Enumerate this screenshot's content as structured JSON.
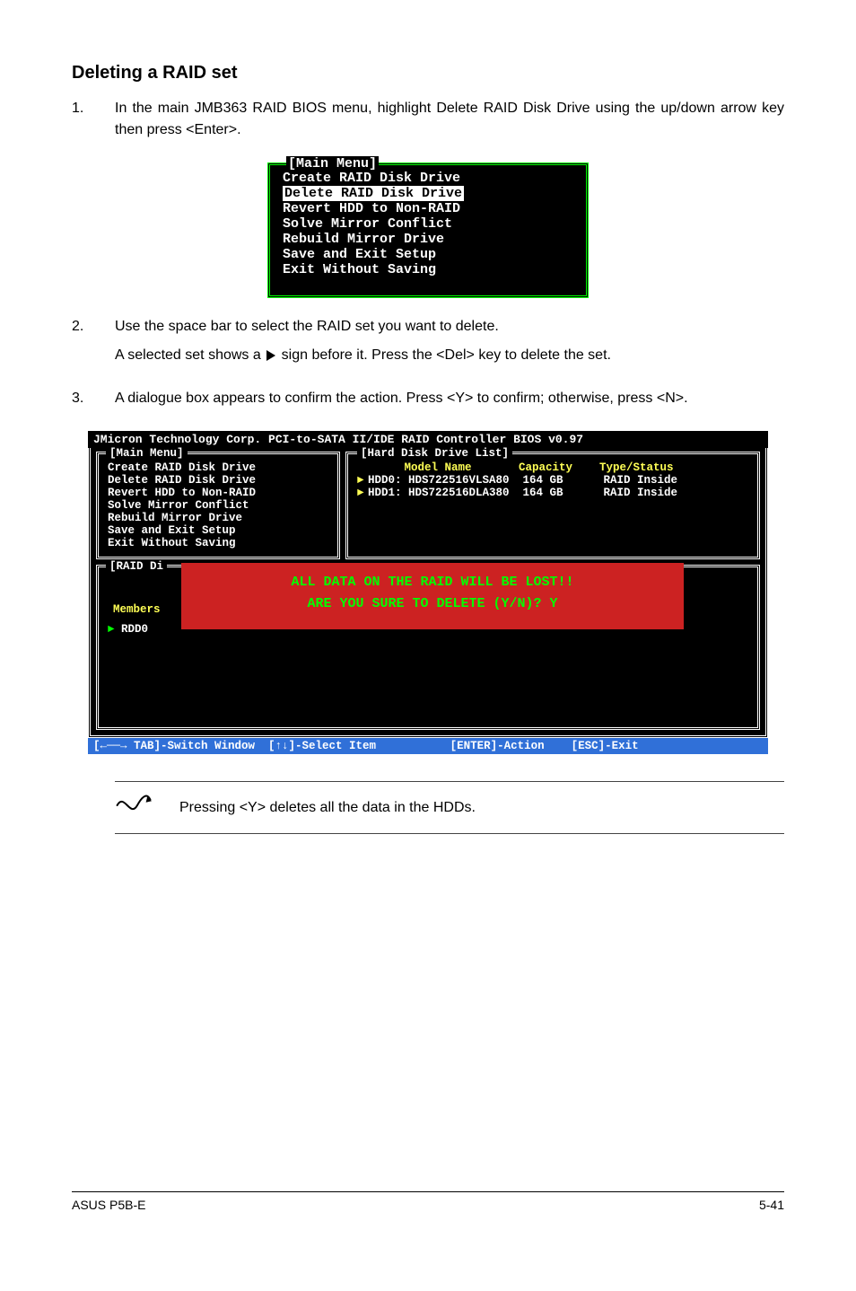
{
  "heading": "Deleting a RAID set",
  "steps": {
    "s1_num": "1.",
    "s1_text": "In the main JMB363 RAID BIOS menu, highlight Delete RAID Disk Drive using the up/down arrow key then press <Enter>.",
    "s2_num": "2.",
    "s2_text_a": "Use the space bar to select the RAID set you want to delete.",
    "s2_text_b_pre": "A selected set shows a ",
    "s2_text_b_post": " sign before it. Press the <Del> key to delete the set.",
    "s3_num": "3.",
    "s3_text": "A dialogue box appears to confirm the action. Press <Y> to confirm; otherwise, press <N>."
  },
  "bios_small": {
    "title": "[Main Menu]",
    "items": [
      "Create RAID Disk Drive",
      "Delete RAID Disk Drive",
      "Revert HDD to Non-RAID",
      "Solve Mirror Conflict",
      "Rebuild Mirror Drive",
      "Save and Exit Setup",
      "Exit Without Saving"
    ],
    "selected_index": 1
  },
  "bios_wide": {
    "header": "JMicron Technology Corp. PCI-to-SATA II/IDE RAID Controller BIOS v0.97",
    "left_title": "[Main Menu]",
    "left_items": [
      "Create RAID Disk Drive",
      "Delete RAID Disk Drive",
      "Revert HDD to Non-RAID",
      "Solve Mirror Conflict",
      "Rebuild Mirror Drive",
      "Save and Exit Setup",
      "Exit Without Saving"
    ],
    "right_title": "[Hard Disk Drive List]",
    "right_header": "       Model Name       Capacity    Type/Status",
    "right_rows": [
      "HDD0: HDS722516VLSA80  164 GB      RAID Inside",
      "HDD1: HDS722516DLA380  164 GB      RAID Inside"
    ],
    "raid_title": "[RAID Di",
    "members_label": "Members",
    "rdd_label": "RDD0",
    "redbox_line1": "ALL DATA ON THE RAID WILL BE LOST!!",
    "redbox_line2": "ARE YOU SURE TO DELETE (Y/N)? Y",
    "footer": "[←──→ TAB]-Switch Window  [↑↓]-Select Item           [ENTER]-Action    [ESC]-Exit"
  },
  "note": "Pressing <Y> deletes all the data in the HDDs.",
  "page_footer_left": "ASUS P5B-E",
  "page_footer_right": "5-41"
}
